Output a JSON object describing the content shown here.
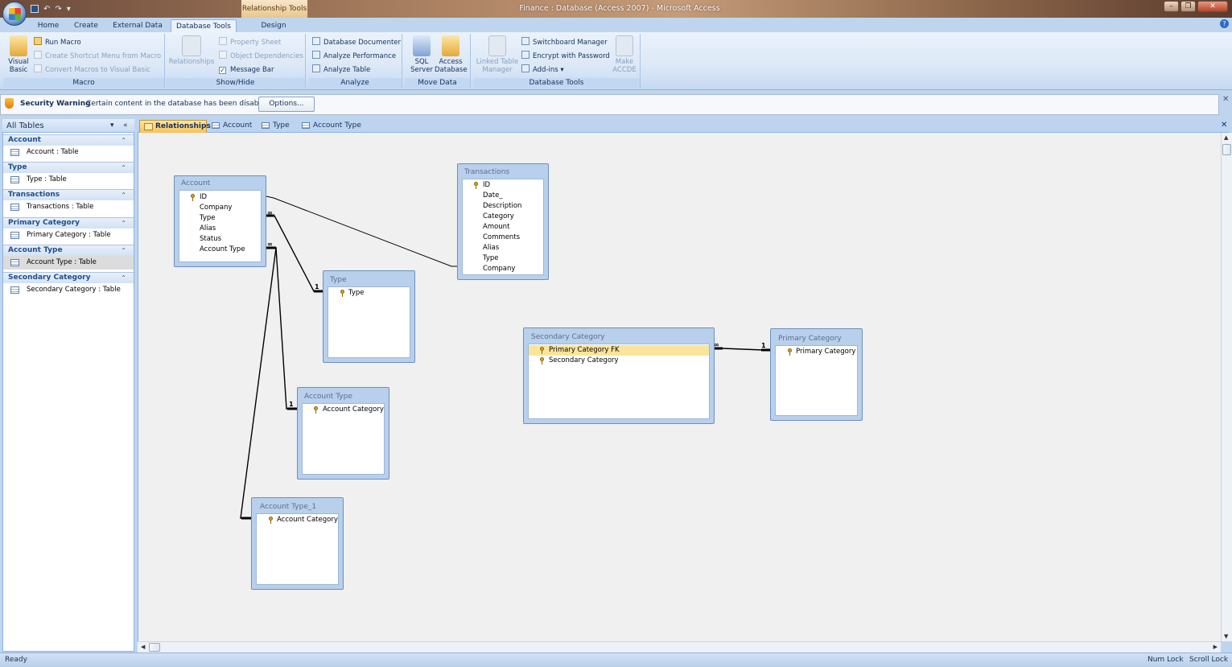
{
  "window": {
    "title": "Finance : Database (Access 2007) - Microsoft Access",
    "context_tab": "Relationship Tools"
  },
  "ribbon_tabs": [
    "Home",
    "Create",
    "External Data",
    "Database Tools",
    "Design"
  ],
  "ribbon": {
    "macro": {
      "label": "Macro",
      "visual_basic": "Visual Basic",
      "run_macro": "Run Macro",
      "create_shortcut": "Create Shortcut Menu from Macro",
      "convert_macros": "Convert Macros to Visual Basic"
    },
    "show_hide": {
      "label": "Show/Hide",
      "relationships": "Relationships",
      "property_sheet": "Property Sheet",
      "object_dependencies": "Object Dependencies",
      "message_bar": "Message Bar",
      "message_bar_checked": true
    },
    "analyze": {
      "label": "Analyze",
      "database_documenter": "Database Documenter",
      "analyze_performance": "Analyze Performance",
      "analyze_table": "Analyze Table"
    },
    "move_data": {
      "label": "Move Data",
      "sql_server": "SQL Server",
      "access_database": "Access Database"
    },
    "database_tools": {
      "label": "Database Tools",
      "linked_table_manager": "Linked Table Manager",
      "switchboard_manager": "Switchboard Manager",
      "encrypt_with_password": "Encrypt with Password",
      "add_ins": "Add-ins",
      "make_accde": "Make ACCDE"
    }
  },
  "security": {
    "title": "Security Warning",
    "message": "Certain content in the database has been disabled",
    "options_label": "Options..."
  },
  "nav": {
    "header": "All Tables",
    "groups": [
      {
        "name": "Account",
        "item": "Account : Table"
      },
      {
        "name": "Type",
        "item": "Type : Table"
      },
      {
        "name": "Transactions",
        "item": "Transactions : Table"
      },
      {
        "name": "Primary Category",
        "item": "Primary Category : Table"
      },
      {
        "name": "Account Type",
        "item": "Account Type : Table",
        "selected": true
      },
      {
        "name": "Secondary Category",
        "item": "Secondary Category : Table"
      }
    ]
  },
  "doc_tabs": [
    "Relationships",
    "Account",
    "Type",
    "Account Type"
  ],
  "tables": {
    "account": {
      "title": "Account",
      "fields": [
        "ID",
        "Company",
        "Type",
        "Alias",
        "Status",
        "Account Type"
      ],
      "key": [
        0
      ]
    },
    "transactions": {
      "title": "Transactions",
      "fields": [
        "ID",
        "Date_",
        "Description",
        "Category",
        "Amount",
        "Comments",
        "Alias",
        "Type",
        "Company"
      ],
      "key": [
        0
      ]
    },
    "type": {
      "title": "Type",
      "fields": [
        "Type"
      ],
      "key": [
        0
      ]
    },
    "account_type": {
      "title": "Account Type",
      "fields": [
        "Account Category"
      ],
      "key": [
        0
      ]
    },
    "account_type_1": {
      "title": "Account Type_1",
      "fields": [
        "Account Category"
      ],
      "key": [
        0
      ]
    },
    "secondary_category": {
      "title": "Secondary Category",
      "fields": [
        "Primary Category FK",
        "Secondary Category"
      ],
      "key": [
        0,
        1
      ],
      "selected_field": 0
    },
    "primary_category": {
      "title": "Primary Category",
      "fields": [
        "Primary Category"
      ],
      "key": [
        0
      ]
    }
  },
  "relationship_labels": {
    "one": "1",
    "many": "∞"
  },
  "status": {
    "left": "Ready",
    "num_lock": "Num Lock",
    "scroll_lock": "Scroll Lock"
  }
}
